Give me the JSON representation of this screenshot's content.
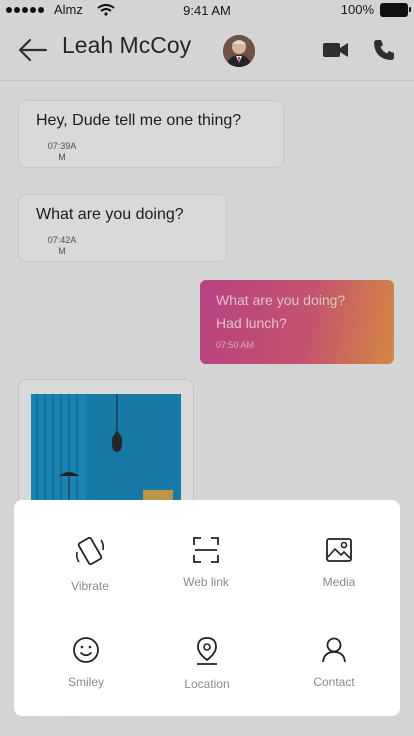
{
  "status_bar": {
    "carrier": "Almz",
    "time": "9:41 AM",
    "battery": "100%"
  },
  "header": {
    "contact_name": "Leah McCoy"
  },
  "messages": [
    {
      "text": "Hey, Dude tell me one thing?",
      "time_a": "07:39A",
      "time_b": "M"
    },
    {
      "text": "What are you doing?",
      "time_a": "07:42A",
      "time_b": "M"
    }
  ],
  "outgoing": {
    "line1": "What are you doing?",
    "line2": "Had lunch?",
    "time": "07:50 AM"
  },
  "attachments": [
    {
      "label": "Vibrate",
      "icon": "vibrate-icon"
    },
    {
      "label": "Web link",
      "icon": "web-link-icon"
    },
    {
      "label": "Media",
      "icon": "media-icon"
    },
    {
      "label": "Smiley",
      "icon": "smiley-icon"
    },
    {
      "label": "Location",
      "icon": "location-icon"
    },
    {
      "label": "Contact",
      "icon": "contact-icon"
    }
  ],
  "colors": {
    "bubble_gradient_start": "#c8488e",
    "bubble_gradient_end": "#e6934a",
    "background": "#e6e6e6",
    "sheet": "#ffffff"
  }
}
